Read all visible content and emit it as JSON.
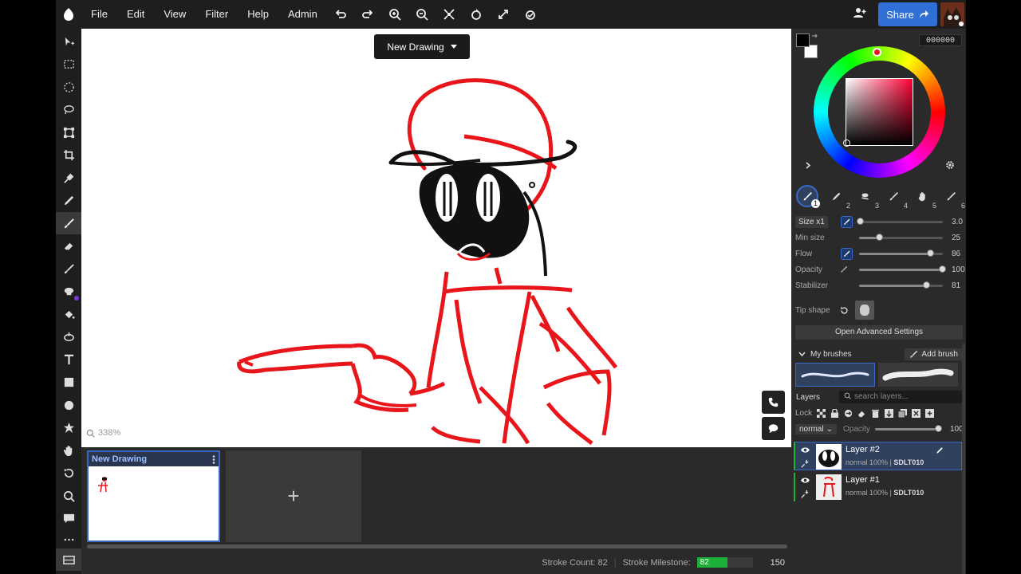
{
  "menu": [
    "File",
    "Edit",
    "View",
    "Filter",
    "Help",
    "Admin"
  ],
  "toolbar_icons": [
    "undo-icon",
    "redo-icon",
    "zoom-in-icon",
    "zoom-out-icon",
    "fit-view-icon",
    "rotate-icon",
    "fullscreen-icon",
    "reset-rotation-icon"
  ],
  "share": {
    "label": "Share"
  },
  "canvas": {
    "doc_menu_label": "New Drawing",
    "zoom": "338%"
  },
  "thumbnails": {
    "title": "New Drawing",
    "add_label": "+"
  },
  "status": {
    "stroke_count": "Stroke Count: 82",
    "milestone_label": "Stroke Milestone:",
    "milestone_value": "82",
    "milestone_target": "150",
    "milestone_fraction": 0.547
  },
  "color": {
    "hex": "000000",
    "primary": "#000000",
    "secondary": "#ffffff"
  },
  "brush_slots": [
    "1",
    "2",
    "3",
    "4",
    "5",
    "6"
  ],
  "brush_settings": {
    "size_label": "Size x1",
    "size_value": "3.0",
    "size_fraction": 0.02,
    "min_size_label": "Min size",
    "min_size_value": "25",
    "min_size_fraction": 0.25,
    "flow_label": "Flow",
    "flow_value": "86",
    "flow_fraction": 0.86,
    "opacity_label": "Opacity",
    "opacity_value": "100",
    "opacity_fraction": 1.0,
    "stabilizer_label": "Stabilizer",
    "stabilizer_value": "81",
    "stabilizer_fraction": 0.81,
    "tip_shape_label": "Tip shape",
    "advanced_label": "Open Advanced Settings"
  },
  "my_brushes": {
    "label": "My brushes",
    "add_label": "Add brush"
  },
  "layers_panel": {
    "title": "Layers",
    "search_placeholder": "search layers...",
    "lock_label": "Lock",
    "blend_mode": "normal",
    "opacity_label": "Opacity",
    "opacity_value": "100",
    "opacity_fraction": 1.0,
    "layers": [
      {
        "name": "Layer #2",
        "mode": "normal 100% |",
        "owner": "SDLT010"
      },
      {
        "name": "Layer #1",
        "mode": "normal 100% |",
        "owner": "SDLT010"
      }
    ]
  }
}
